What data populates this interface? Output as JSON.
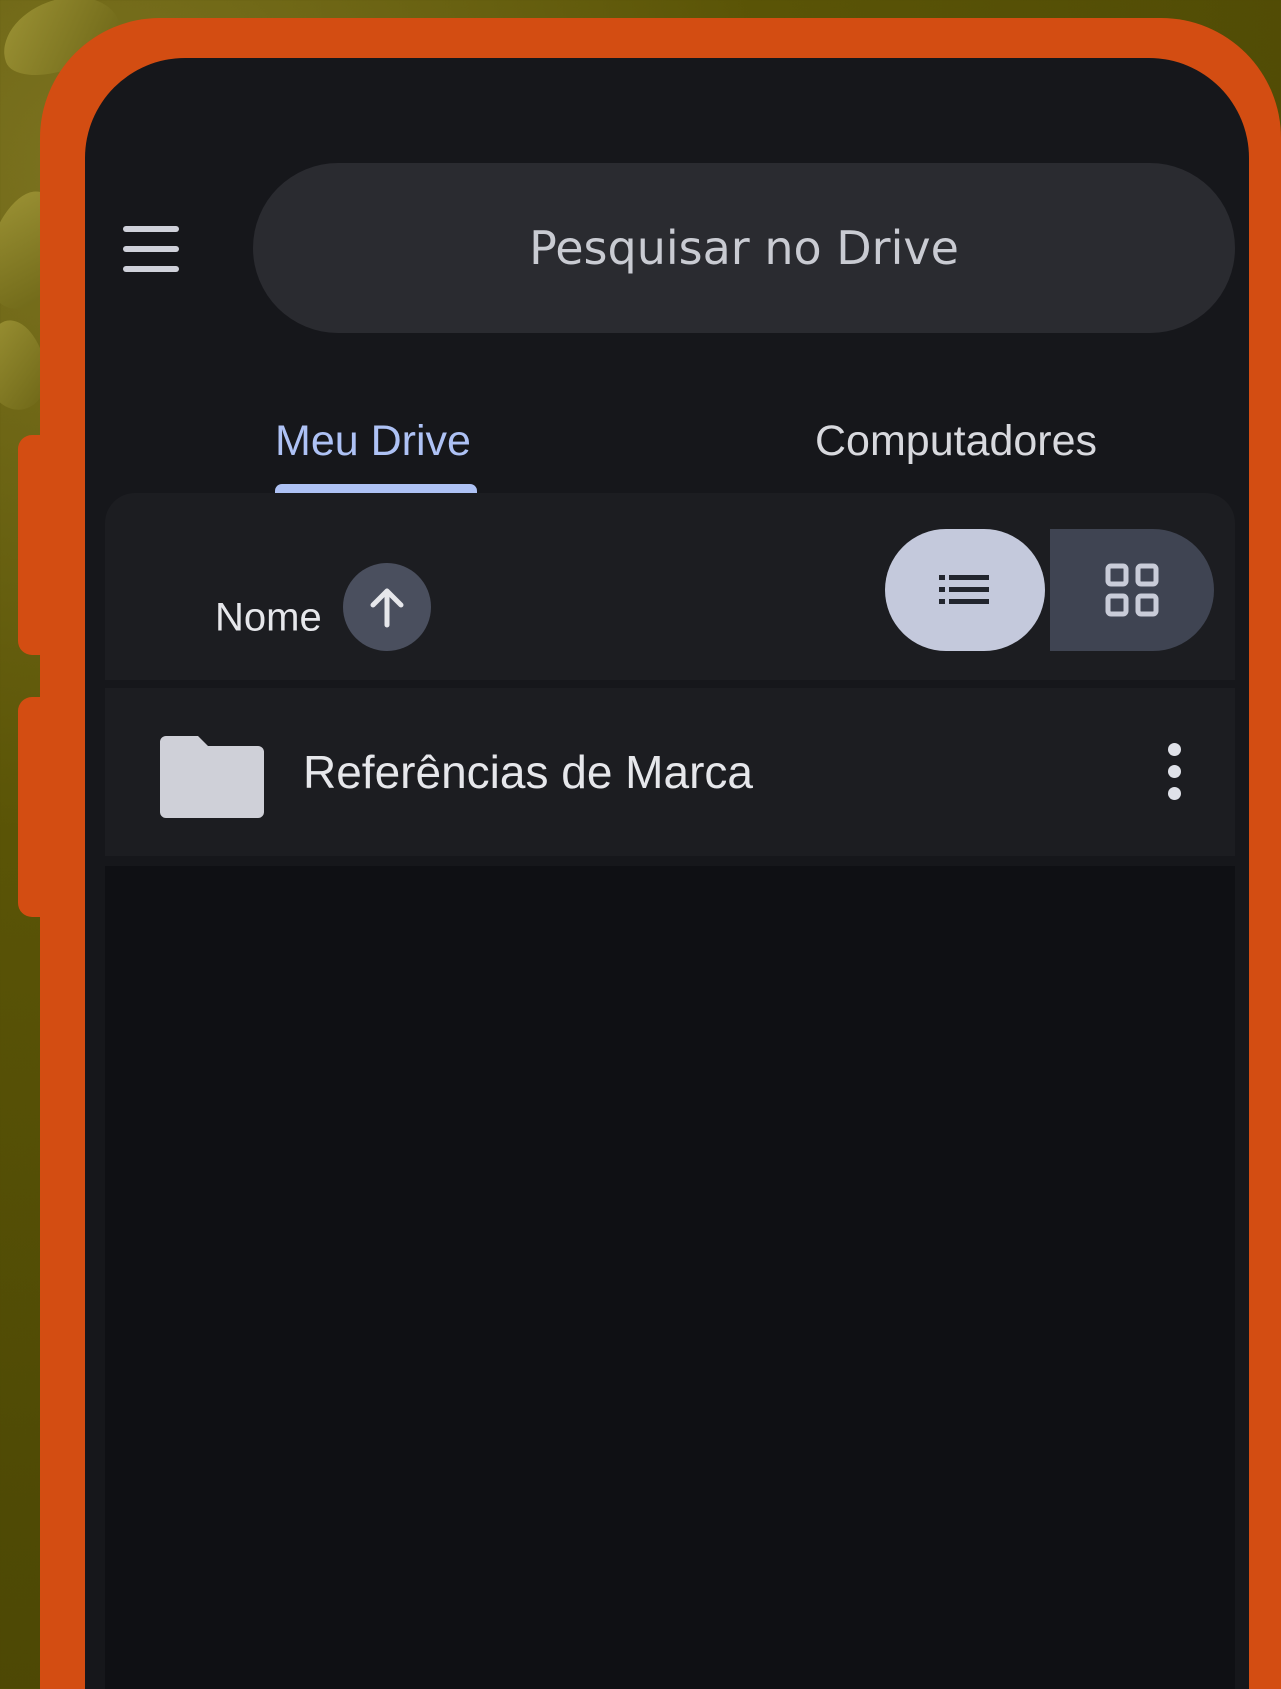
{
  "search": {
    "placeholder": "Pesquisar no Drive"
  },
  "tabs": [
    {
      "label": "Meu Drive",
      "active": true
    },
    {
      "label": "Computadores",
      "active": false
    }
  ],
  "sort": {
    "label": "Nome",
    "direction_icon": "arrow-up-icon"
  },
  "view_toggle": {
    "list_icon": "list-view-icon",
    "grid_icon": "grid-view-icon",
    "selected": "list"
  },
  "files": [
    {
      "name": "Referências de Marca",
      "type": "folder",
      "icon": "folder-icon",
      "menu_icon": "more-vert-icon"
    }
  ],
  "colors": {
    "frame": "#d34d12",
    "background": "#4f4a05",
    "screen": "#16171b",
    "accent": "#aec2f5"
  }
}
